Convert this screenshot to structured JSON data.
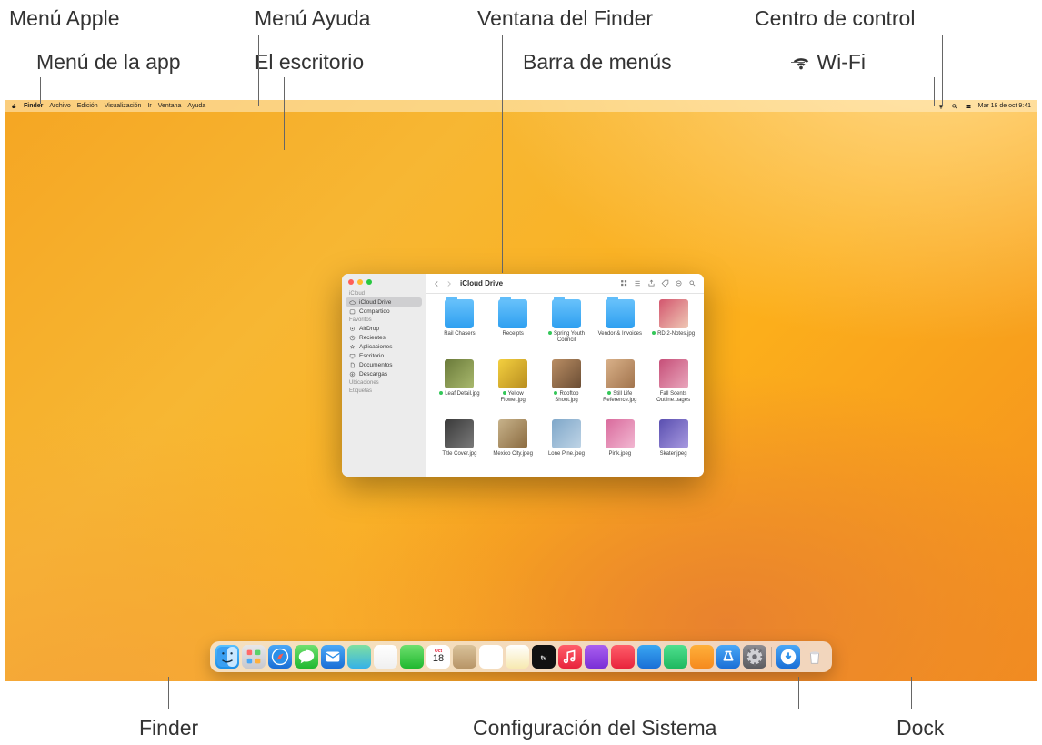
{
  "callouts": {
    "top": {
      "apple_menu": "Menú Apple",
      "app_menu": "Menú de la app",
      "help_menu": "Menú Ayuda",
      "desktop": "El escritorio",
      "finder_window": "Ventana del Finder",
      "menu_bar": "Barra de menús",
      "control_center": "Centro de control",
      "wifi": "Wi-Fi"
    },
    "bottom": {
      "finder": "Finder",
      "system_settings": "Configuración del Sistema",
      "dock": "Dock"
    }
  },
  "menubar": {
    "app_name": "Finder",
    "items": [
      "Archivo",
      "Edición",
      "Visualización",
      "Ir",
      "Ventana",
      "Ayuda"
    ],
    "clock": "Mar 18 de oct  9:41"
  },
  "finder": {
    "title": "iCloud Drive",
    "sidebar": {
      "sections": [
        {
          "label": "iCloud",
          "items": [
            {
              "icon": "cloud",
              "label": "iCloud Drive",
              "selected": true
            },
            {
              "icon": "share",
              "label": "Compartido"
            }
          ]
        },
        {
          "label": "Favoritos",
          "items": [
            {
              "icon": "airdrop",
              "label": "AirDrop"
            },
            {
              "icon": "clock",
              "label": "Recientes"
            },
            {
              "icon": "apps",
              "label": "Aplicaciones"
            },
            {
              "icon": "desktop",
              "label": "Escritorio"
            },
            {
              "icon": "doc",
              "label": "Documentos"
            },
            {
              "icon": "download",
              "label": "Descargas"
            }
          ]
        },
        {
          "label": "Ubicaciones",
          "items": []
        },
        {
          "label": "Etiquetas",
          "items": []
        }
      ]
    },
    "files": [
      {
        "type": "folder",
        "label": "Rail Chasers"
      },
      {
        "type": "folder",
        "label": "Receipts"
      },
      {
        "type": "folder",
        "label": "Spring Youth Council",
        "dot": true
      },
      {
        "type": "folder",
        "label": "Vendor & Invoices"
      },
      {
        "type": "img",
        "label": "RD.2-Notes.jpg",
        "c1": "#d3566e",
        "c2": "#efc9b5",
        "dot": true
      },
      {
        "type": "img",
        "label": "Leaf Detail.jpg",
        "c1": "#6a7a3a",
        "c2": "#a9b96d",
        "dot": true
      },
      {
        "type": "img",
        "label": "Yellow Flower.jpg",
        "c1": "#f3cf3f",
        "c2": "#b88d1f",
        "dot": true
      },
      {
        "type": "img",
        "label": "Rooftop Shoot.jpg",
        "c1": "#b98d63",
        "c2": "#6a4d34",
        "dot": true
      },
      {
        "type": "img",
        "label": "Still Life Reference.jpg",
        "c1": "#d9b189",
        "c2": "#a1734c",
        "dot": true
      },
      {
        "type": "img",
        "label": "Fall Scents Outline.pages",
        "c1": "#c64f78",
        "c2": "#e9a7bd"
      },
      {
        "type": "img",
        "label": "Title Cover.jpg",
        "c1": "#3a3a3a",
        "c2": "#7a7a7a"
      },
      {
        "type": "img",
        "label": "Mexico City.jpeg",
        "c1": "#c7b28a",
        "c2": "#8a6a3f"
      },
      {
        "type": "img",
        "label": "Lone Pine.jpeg",
        "c1": "#7fa7c9",
        "c2": "#bfd4e6"
      },
      {
        "type": "img",
        "label": "Pink.jpeg",
        "c1": "#d96a9c",
        "c2": "#f2b8d2"
      },
      {
        "type": "img",
        "label": "Skater.jpeg",
        "c1": "#5a4fb0",
        "c2": "#a89ae0"
      }
    ]
  },
  "dock": {
    "apps": [
      {
        "name": "finder",
        "bg": "linear-gradient(#57c1ff,#1d8fe8)"
      },
      {
        "name": "launchpad",
        "bg": "linear-gradient(#e7e7ea,#c8c8cd)"
      },
      {
        "name": "safari",
        "bg": "linear-gradient(#4aa8f7,#1a6fd6)"
      },
      {
        "name": "messages",
        "bg": "linear-gradient(#6fe06f,#1fb82f)"
      },
      {
        "name": "mail",
        "bg": "linear-gradient(#4aa8f7,#1a6fd6)"
      },
      {
        "name": "maps",
        "bg": "linear-gradient(#7fe0a0,#35b1e8)"
      },
      {
        "name": "photos",
        "bg": "linear-gradient(#fff,#f0f0f0)"
      },
      {
        "name": "facetime",
        "bg": "linear-gradient(#6fe06f,#1fb82f)"
      },
      {
        "name": "calendar",
        "bg": "#fff"
      },
      {
        "name": "contacts",
        "bg": "linear-gradient(#d9c29a,#b89567)"
      },
      {
        "name": "reminders",
        "bg": "#fff"
      },
      {
        "name": "notes",
        "bg": "linear-gradient(#fff,#f7e9b0)"
      },
      {
        "name": "tv",
        "bg": "#111"
      },
      {
        "name": "music",
        "bg": "linear-gradient(#ff5e6a,#e8233c)"
      },
      {
        "name": "podcasts",
        "bg": "linear-gradient(#aa5ff0,#7a2fd6)"
      },
      {
        "name": "news",
        "bg": "linear-gradient(#ff5e6a,#e8233c)"
      },
      {
        "name": "keynote",
        "bg": "linear-gradient(#3aa7f2,#1a6fd6)"
      },
      {
        "name": "numbers",
        "bg": "linear-gradient(#4fe08f,#1fb85f)"
      },
      {
        "name": "pages",
        "bg": "linear-gradient(#ffb03a,#f58a1e)"
      },
      {
        "name": "appstore",
        "bg": "linear-gradient(#4aa8f7,#1a6fd6)"
      },
      {
        "name": "system-settings",
        "bg": "linear-gradient(#8d8d92,#5b5b60)"
      }
    ],
    "right": [
      {
        "name": "downloads",
        "bg": "linear-gradient(#4aa8f7,#1a6fd6)"
      },
      {
        "name": "trash",
        "bg": "linear-gradient(#e7e7ea,#c1c1c6)"
      }
    ],
    "calendar_day": "18",
    "calendar_month": "Oct"
  }
}
